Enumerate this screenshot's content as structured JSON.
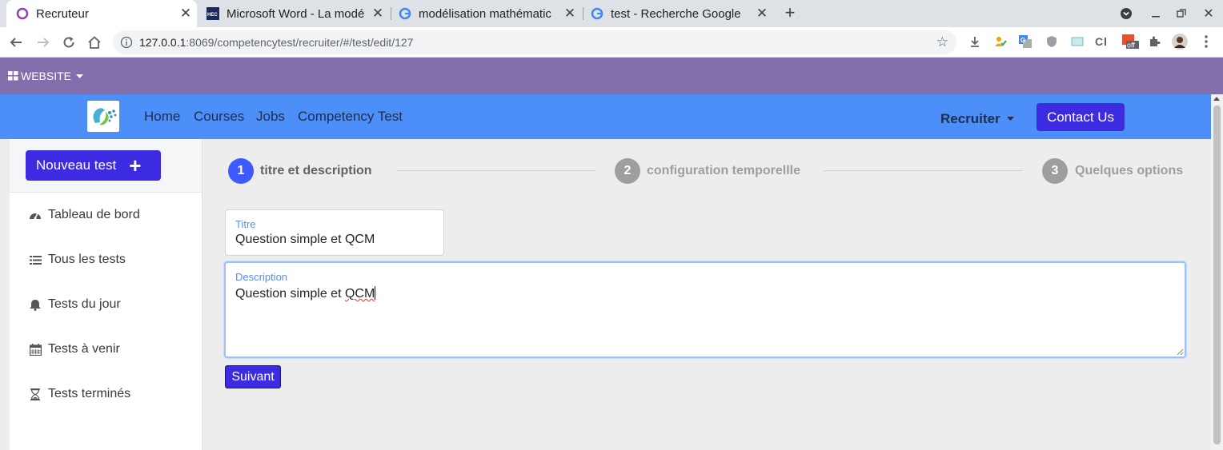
{
  "browser": {
    "tabs": [
      {
        "title": "Recruteur",
        "icon": "circle-o-icon"
      },
      {
        "title": "Microsoft Word - La modé",
        "icon": "hec-icon"
      },
      {
        "title": "modélisation mathématic",
        "icon": "google-icon"
      },
      {
        "title": "test - Recherche Google",
        "icon": "google-icon"
      }
    ],
    "url_host": "127.0.0.1",
    "url_rest": ":8069/competencytest/recruiter/#/test/edit/127",
    "ext_badge": "off"
  },
  "website_bar": {
    "label": "WEBSITE"
  },
  "navbar": {
    "links": [
      "Home",
      "Courses",
      "Jobs",
      "Competency Test"
    ],
    "recruiter": "Recruiter",
    "contact": "Contact Us"
  },
  "sidebar": {
    "new_test": "Nouveau test",
    "items": [
      {
        "label": "Tableau de bord",
        "icon": "dashboard-icon"
      },
      {
        "label": "Tous les tests",
        "icon": "list-icon"
      },
      {
        "label": "Tests du jour",
        "icon": "bell-icon"
      },
      {
        "label": "Tests à venir",
        "icon": "calendar-icon"
      },
      {
        "label": "Tests terminés",
        "icon": "hourglass-icon"
      }
    ]
  },
  "stepper": {
    "steps": [
      {
        "num": "1",
        "label": "titre et description"
      },
      {
        "num": "2",
        "label": "configuration temporellle"
      },
      {
        "num": "3",
        "label": "Quelques options"
      }
    ],
    "active_color": "#3d5afe",
    "inactive_color": "#9e9e9e"
  },
  "form": {
    "title_label": "Titre",
    "title_value": "Question simple et QCM",
    "description_label": "Description",
    "description_prefix": "Question simple et ",
    "description_misspelled": "QCM",
    "next_button": "Suivant"
  },
  "colors": {
    "primary": "#3d2be2",
    "navbar": "#4c8ff8",
    "website_bar": "#836fab"
  }
}
